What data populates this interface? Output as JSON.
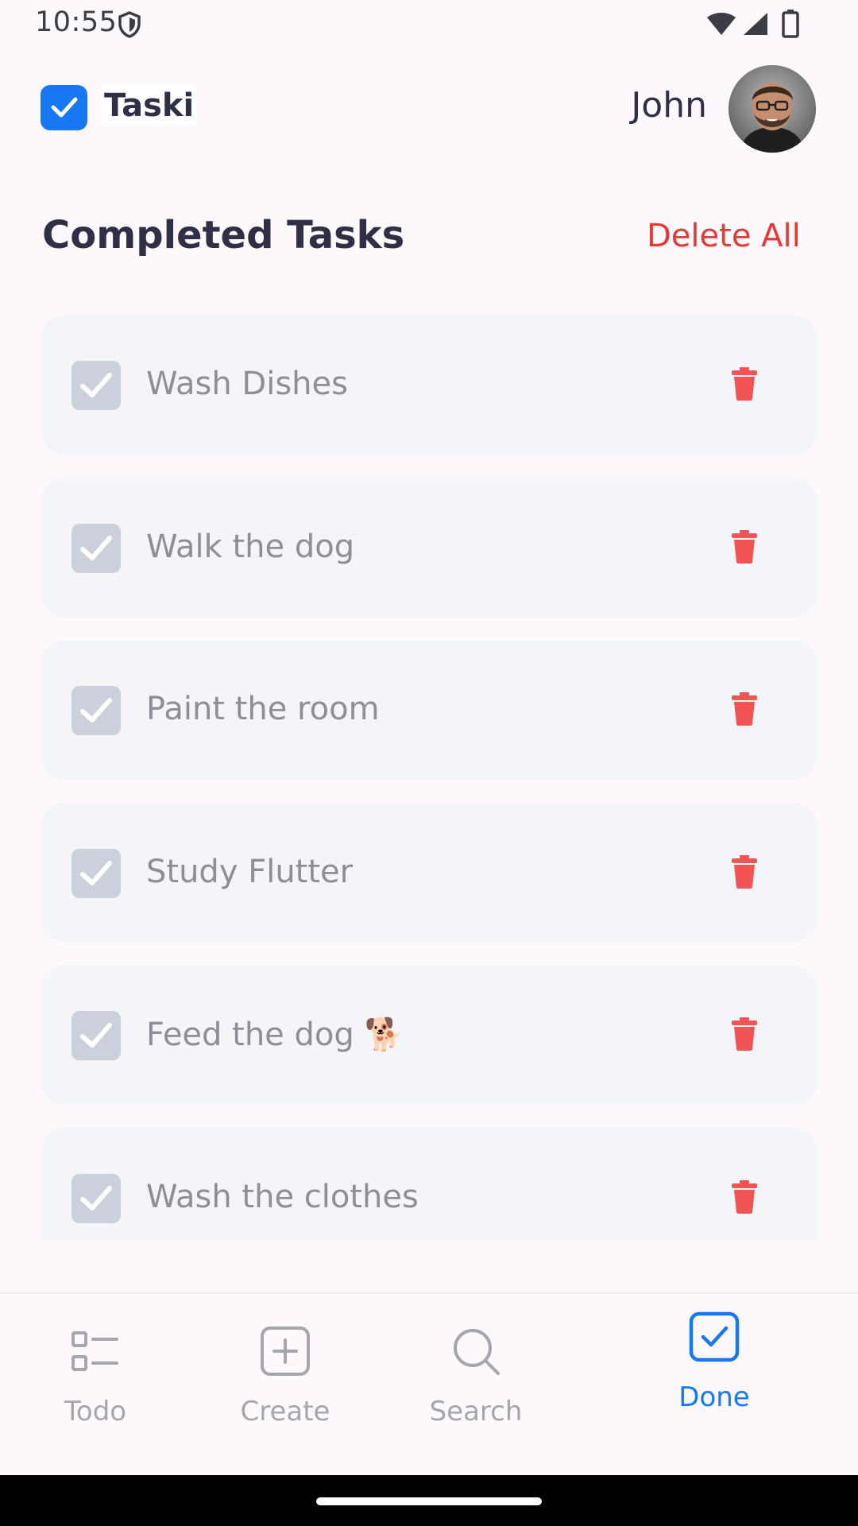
{
  "status_bar": {
    "time": "10:55",
    "icons": [
      "shield-icon",
      "wifi-icon",
      "signal-icon",
      "battery-icon"
    ]
  },
  "header": {
    "logo_text": "Taski",
    "user_name": "John"
  },
  "section": {
    "title": "Completed Tasks",
    "delete_all_label": "Delete All"
  },
  "tasks": [
    {
      "title": "Wash Dishes",
      "completed": true
    },
    {
      "title": "Walk the dog",
      "completed": true
    },
    {
      "title": "Paint the room",
      "completed": true
    },
    {
      "title": "Study Flutter",
      "completed": true
    },
    {
      "title": "Feed the dog 🐕",
      "completed": true
    },
    {
      "title": "Wash the clothes",
      "completed": true
    }
  ],
  "bottom_nav": {
    "items": [
      {
        "label": "Todo",
        "icon": "list-icon",
        "active": false
      },
      {
        "label": "Create",
        "icon": "add-box-icon",
        "active": false
      },
      {
        "label": "Search",
        "icon": "search-icon",
        "active": false
      },
      {
        "label": "Done",
        "icon": "checkbox-icon",
        "active": true
      }
    ]
  },
  "colors": {
    "accent": "#1877f2",
    "danger": "#e53935",
    "text_dark": "#2f3046",
    "text_muted": "#8e8f96",
    "card_bg": "#f4f5f8",
    "check_bg": "#cbd0da"
  }
}
